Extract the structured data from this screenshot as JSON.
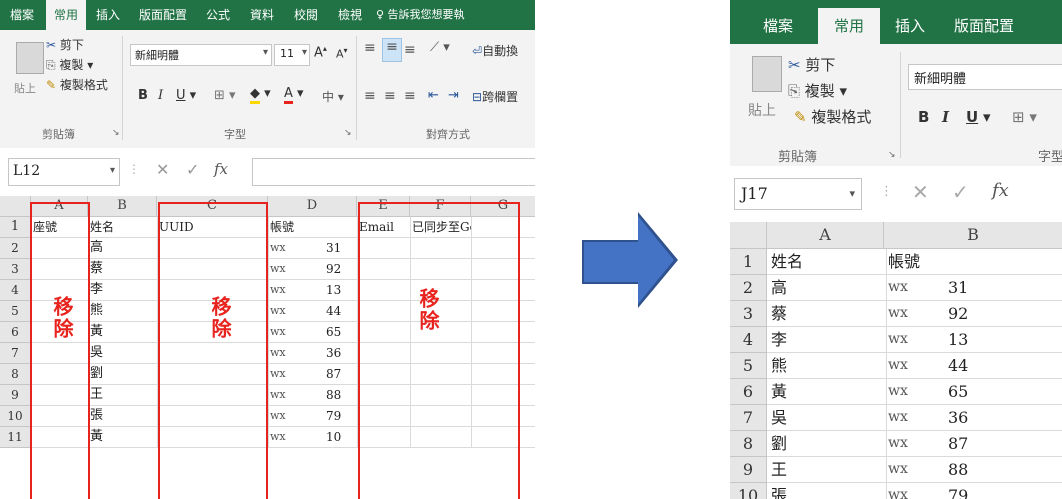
{
  "left": {
    "tabs": [
      "檔案",
      "常用",
      "插入",
      "版面配置",
      "公式",
      "資料",
      "校閱",
      "檢視",
      "♀ 告訴我您想要執"
    ],
    "active_tab": "常用",
    "ribbon": {
      "cut": "剪下",
      "copy": "複製 ▾",
      "format_painter": "複製格式",
      "paste": "貼上",
      "font_name": "新細明體",
      "font_size": "11",
      "bold": "B",
      "italic": "I",
      "underline": "U",
      "wrap": "自動換",
      "merge": "跨欄置"
    },
    "groups": [
      "剪貼簿",
      "字型",
      "對齊方式"
    ],
    "name_box": "L12",
    "fx": "fx",
    "columns": [
      "A",
      "B",
      "C",
      "D",
      "E",
      "F",
      "G"
    ],
    "header_row": [
      "座號",
      "姓名",
      "UUID",
      "帳號",
      "Email",
      "已同步至Google",
      ""
    ],
    "rows": [
      {
        "n": "2",
        "name": "高",
        "acct": "wx",
        "tail": "31"
      },
      {
        "n": "3",
        "name": "蔡",
        "acct": "wx",
        "tail": "92"
      },
      {
        "n": "4",
        "name": "李",
        "acct": "wx",
        "tail": "13"
      },
      {
        "n": "5",
        "name": "熊",
        "acct": "wx",
        "tail": "44"
      },
      {
        "n": "6",
        "name": "黃",
        "acct": "wx",
        "tail": "65"
      },
      {
        "n": "7",
        "name": "吳",
        "acct": "wx",
        "tail": "36"
      },
      {
        "n": "8",
        "name": "劉",
        "acct": "wx",
        "tail": "87"
      },
      {
        "n": "9",
        "name": "王",
        "acct": "wx",
        "tail": "88"
      },
      {
        "n": "10",
        "name": "張",
        "acct": "wx",
        "tail": "79"
      },
      {
        "n": "11",
        "name": "黃",
        "acct": "wx",
        "tail": "10"
      }
    ],
    "remove_label": "移除"
  },
  "right": {
    "tabs": [
      "檔案",
      "常用",
      "插入",
      "版面配置"
    ],
    "active_tab": "常用",
    "ribbon": {
      "cut": "剪下",
      "copy": "複製 ▾",
      "format_painter": "複製格式",
      "paste": "貼上",
      "font_name": "新細明體",
      "bold": "B",
      "italic": "I",
      "underline": "U"
    },
    "groups": [
      "剪貼簿",
      "字型"
    ],
    "name_box": "J17",
    "fx": "fx",
    "columns": [
      "A",
      "B"
    ],
    "header_row": [
      "姓名",
      "帳號"
    ],
    "rows": [
      {
        "n": "2",
        "name": "高",
        "acct": "wx",
        "tail": "31"
      },
      {
        "n": "3",
        "name": "蔡",
        "acct": "wx",
        "tail": "92"
      },
      {
        "n": "4",
        "name": "李",
        "acct": "wx",
        "tail": "13"
      },
      {
        "n": "5",
        "name": "熊",
        "acct": "wx",
        "tail": "44"
      },
      {
        "n": "6",
        "name": "黃",
        "acct": "wx",
        "tail": "65"
      },
      {
        "n": "7",
        "name": "吳",
        "acct": "wx",
        "tail": "36"
      },
      {
        "n": "8",
        "name": "劉",
        "acct": "wx",
        "tail": "87"
      },
      {
        "n": "9",
        "name": "王",
        "acct": "wx",
        "tail": "88"
      },
      {
        "n": "10",
        "name": "張",
        "acct": "wx",
        "tail": "79"
      }
    ]
  },
  "colors": {
    "excel_green": "#217346",
    "remove_red": "#e8231d",
    "arrow_blue": "#4472c4"
  }
}
